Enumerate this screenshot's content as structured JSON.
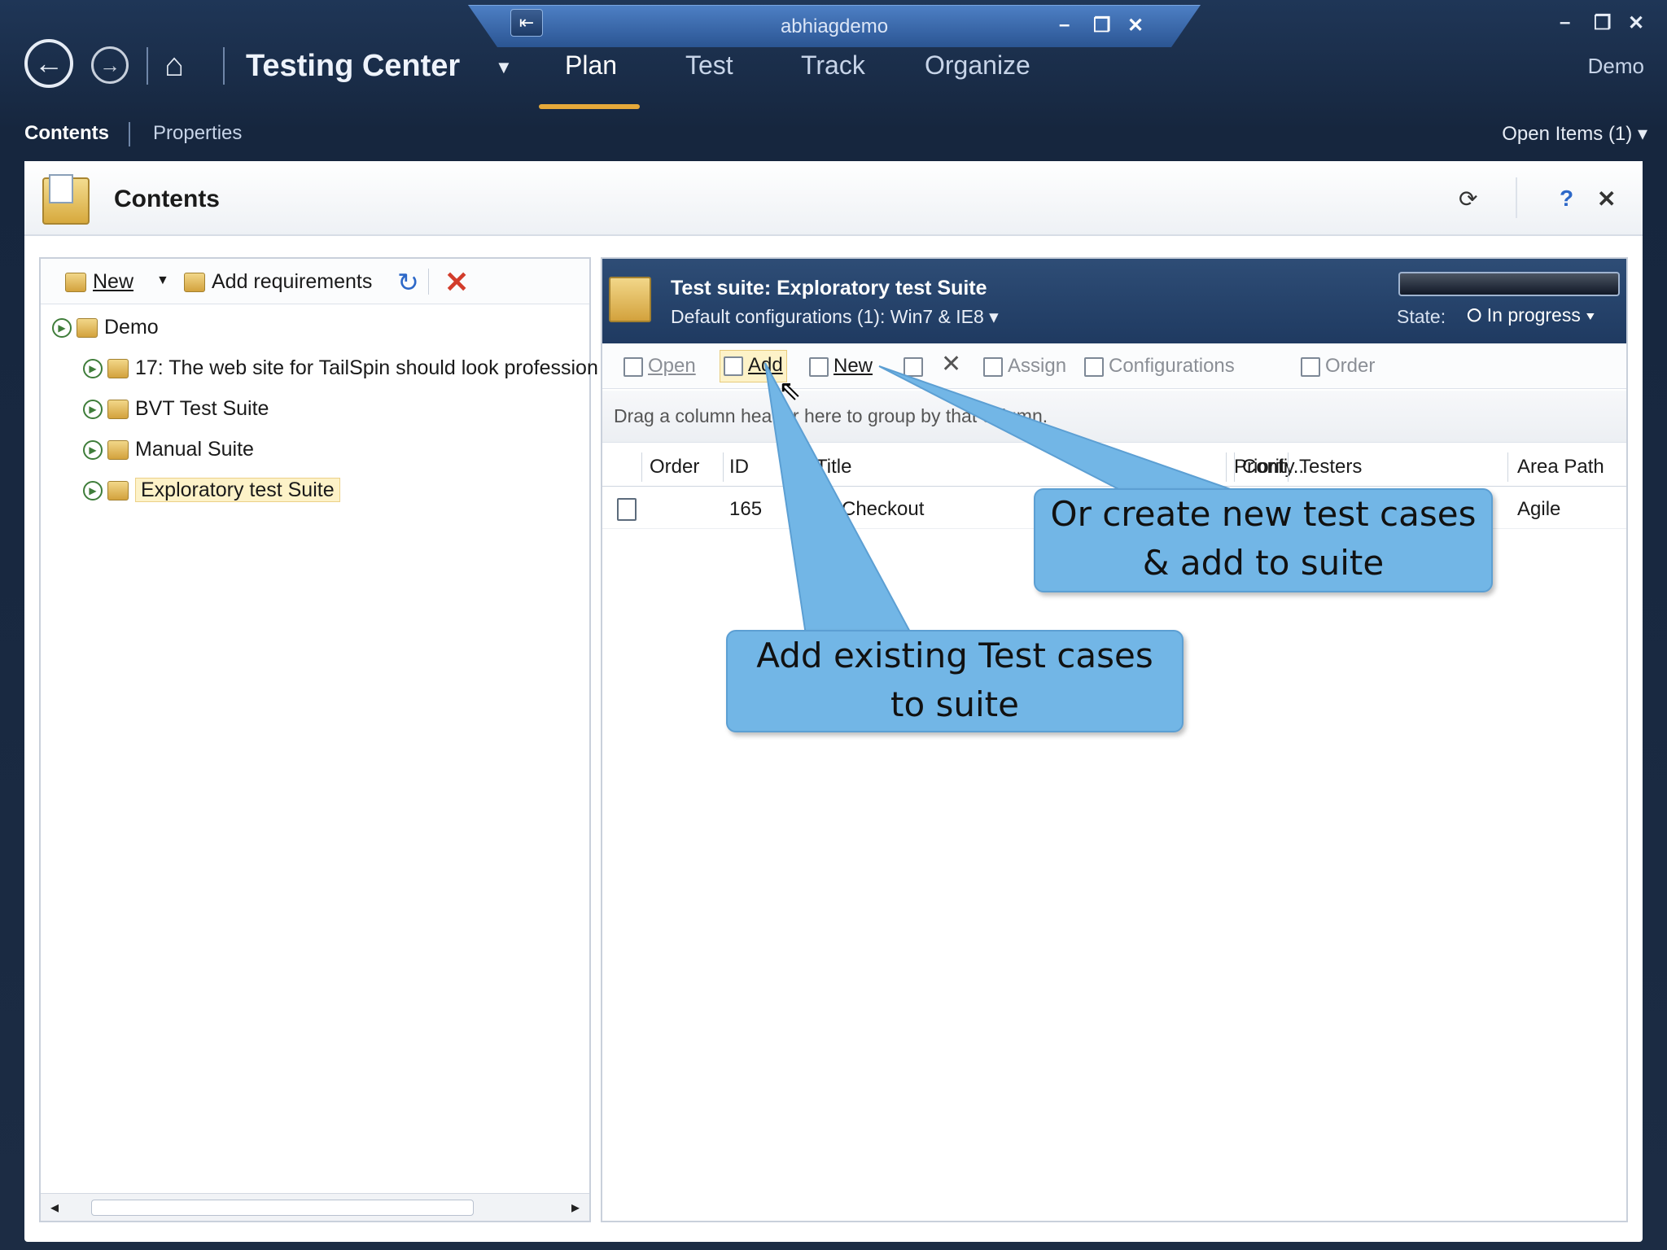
{
  "window": {
    "title": "abhiagdemo",
    "pin_glyph": "⇤",
    "inner_controls": [
      "–",
      "❐",
      "✕"
    ],
    "outer_controls": [
      "–",
      "❐",
      "✕"
    ]
  },
  "nav": {
    "back_glyph": "←",
    "forward_glyph": "→",
    "home_glyph": "⌂",
    "app_title": "Testing Center",
    "caret": "▼",
    "tabs": [
      "Plan",
      "Test",
      "Track",
      "Organize"
    ],
    "active_tab": "Plan",
    "user": "Demo"
  },
  "subnav": {
    "tabs": [
      "Contents",
      "Properties"
    ],
    "open_items": "Open Items (1) ▾"
  },
  "panel": {
    "title": "Contents",
    "header_icons": [
      "refresh-icon",
      "help-icon",
      "close-icon"
    ],
    "help_glyph": "?",
    "close_glyph": "✕",
    "refresh_glyph": "⟳"
  },
  "left": {
    "toolbar": {
      "new_label": "New",
      "new_caret": "▼",
      "add_req_label": "Add requirements",
      "refresh_glyph": "↻",
      "delete_glyph": "✕"
    },
    "tree": [
      {
        "label": "Demo",
        "level": 0
      },
      {
        "label": "17: The web site for TailSpin should look profession",
        "level": 1
      },
      {
        "label": "BVT Test Suite",
        "level": 1
      },
      {
        "label": "Manual Suite",
        "level": 1
      },
      {
        "label": "Exploratory test Suite",
        "level": 1,
        "selected": true
      }
    ],
    "expander_glyph": "▶",
    "scroll_left": "◂",
    "scroll_right": "▸"
  },
  "right": {
    "suite_title": "Test suite:  Exploratory test Suite",
    "suite_config": "Default configurations (1):  Win7 & IE8 ▾",
    "state_label": "State:",
    "state_value": "⭘ In progress ▾",
    "toolbar": {
      "open": "Open",
      "add": "Add",
      "new": "New",
      "remove_glyph": "✕",
      "assign": "Assign",
      "configurations": "Configurations",
      "order": "Order"
    },
    "group_hint": "Drag a column header here to group by that column.",
    "columns": [
      "Order",
      "ID",
      "Title",
      "Priority",
      "Confi...",
      "Testers",
      "Area Path"
    ],
    "rows": [
      {
        "order": "",
        "id": "165",
        "title": "Checkout",
        "priority": "",
        "config": "",
        "testers": "",
        "area": "Agile"
      }
    ]
  },
  "callouts": {
    "add_existing": "Add existing Test cases\nto suite",
    "create_new": "Or create new test cases\n& add to suite"
  },
  "colors": {
    "titlebar": "#1f3657",
    "accent": "#e6a93a",
    "callout": "#72b6e6",
    "delete": "#d23c2b"
  }
}
